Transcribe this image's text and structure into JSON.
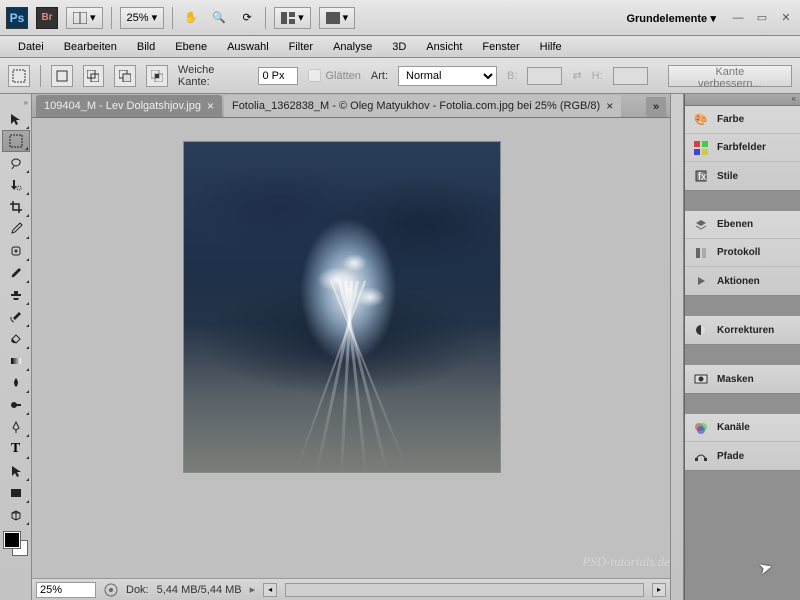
{
  "topbar": {
    "zoom": "25%",
    "workspace": "Grundelemente"
  },
  "menu": [
    "Datei",
    "Bearbeiten",
    "Bild",
    "Ebene",
    "Auswahl",
    "Filter",
    "Analyse",
    "3D",
    "Ansicht",
    "Fenster",
    "Hilfe"
  ],
  "options": {
    "weiche_kante_label": "Weiche Kante:",
    "weiche_kante_value": "0 Px",
    "glaetten_label": "Glätten",
    "art_label": "Art:",
    "art_value": "Normal",
    "b_label": "B:",
    "h_label": "H:",
    "kante_btn": "Kante verbessern..."
  },
  "tabs": [
    {
      "label": "109404_M - Lev Dolgatshjov.jpg",
      "active": false
    },
    {
      "label": "Fotolia_1362838_M - © Oleg Matyukhov - Fotolia.com.jpg bei 25% (RGB/8)",
      "active": true
    }
  ],
  "status": {
    "zoom": "25%",
    "dok_label": "Dok:",
    "dok_value": "5,44 MB/5,44 MB"
  },
  "panels": {
    "group1": [
      {
        "icon": "palette-icon",
        "label": "Farbe"
      },
      {
        "icon": "swatches-icon",
        "label": "Farbfelder"
      },
      {
        "icon": "styles-icon",
        "label": "Stile"
      }
    ],
    "group2": [
      {
        "icon": "layers-icon",
        "label": "Ebenen"
      },
      {
        "icon": "history-icon",
        "label": "Protokoll"
      },
      {
        "icon": "actions-icon",
        "label": "Aktionen"
      }
    ],
    "group3": [
      {
        "icon": "adjust-icon",
        "label": "Korrekturen"
      }
    ],
    "group4": [
      {
        "icon": "masks-icon",
        "label": "Masken"
      }
    ],
    "group5": [
      {
        "icon": "channels-icon",
        "label": "Kanäle"
      },
      {
        "icon": "paths-icon",
        "label": "Pfade"
      }
    ]
  },
  "watermark": "PSD-tutorials.de"
}
